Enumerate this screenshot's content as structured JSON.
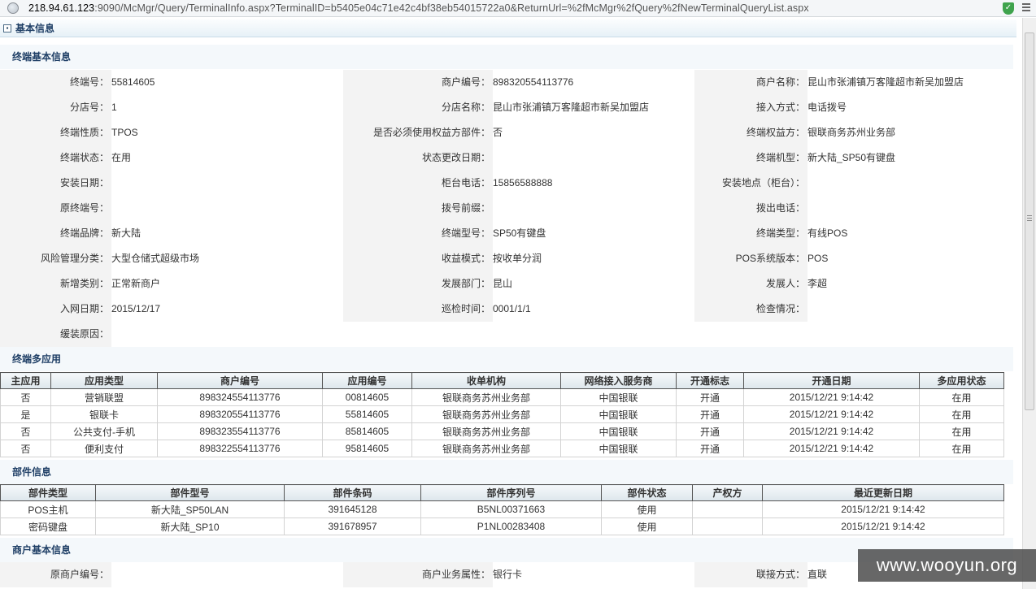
{
  "browser": {
    "url_host": "218.94.61.123",
    "url_rest": ":9090/McMgr/Query/TerminalInfo.aspx?TerminalID=b5405e04c71e42c4bf38eb54015722a0&ReturnUrl=%2fMcMgr%2fQuery%2fNewTerminalQueryList.aspx",
    "shield_glyph": "✓"
  },
  "panel": {
    "title": "基本信息",
    "collapse_glyph": "▪"
  },
  "terminal_basic": {
    "title": "终端基本信息",
    "rows": [
      [
        {
          "label": "终端号：",
          "value": "55814605"
        },
        {
          "label": "商户编号：",
          "value": "898320554113776"
        },
        {
          "label": "商户名称：",
          "value": "昆山市张浦镇万客隆超市新吴加盟店"
        }
      ],
      [
        {
          "label": "分店号：",
          "value": "1"
        },
        {
          "label": "分店名称：",
          "value": "昆山市张浦镇万客隆超市新吴加盟店"
        },
        {
          "label": "接入方式：",
          "value": "电话拨号"
        }
      ],
      [
        {
          "label": "终端性质：",
          "value": "TPOS"
        },
        {
          "label": "是否必须使用权益方部件：",
          "value": "否"
        },
        {
          "label": "终端权益方：",
          "value": "银联商务苏州业务部"
        }
      ],
      [
        {
          "label": "终端状态：",
          "value": "在用"
        },
        {
          "label": "状态更改日期：",
          "value": ""
        },
        {
          "label": "终端机型：",
          "value": "新大陆_SP50有键盘"
        }
      ],
      [
        {
          "label": "安装日期：",
          "value": ""
        },
        {
          "label": "柜台电话：",
          "value": "15856588888"
        },
        {
          "label": "安装地点（柜台）：",
          "value": ""
        }
      ],
      [
        {
          "label": "原终端号：",
          "value": ""
        },
        {
          "label": "拨号前缀：",
          "value": ""
        },
        {
          "label": "拨出电话：",
          "value": ""
        }
      ],
      [
        {
          "label": "终端品牌：",
          "value": "新大陆"
        },
        {
          "label": "终端型号：",
          "value": "SP50有键盘"
        },
        {
          "label": "终端类型：",
          "value": "有线POS"
        }
      ],
      [
        {
          "label": "风险管理分类：",
          "value": "大型仓储式超级市场"
        },
        {
          "label": "收益模式：",
          "value": "按收单分润"
        },
        {
          "label": "POS系统版本：",
          "value": "POS"
        }
      ],
      [
        {
          "label": "新增类别：",
          "value": "正常新商户"
        },
        {
          "label": "发展部门：",
          "value": "昆山"
        },
        {
          "label": "发展人：",
          "value": "李超"
        }
      ],
      [
        {
          "label": "入网日期：",
          "value": "2015/12/17"
        },
        {
          "label": "巡检时间：",
          "value": "0001/1/1"
        },
        {
          "label": "检查情况：",
          "value": ""
        }
      ]
    ],
    "last_row": {
      "label": "缓装原因：",
      "value": ""
    }
  },
  "multi_app": {
    "title": "终端多应用",
    "headers": [
      "主应用",
      "应用类型",
      "商户编号",
      "应用编号",
      "收单机构",
      "网络接入服务商",
      "开通标志",
      "开通日期",
      "多应用状态"
    ],
    "rows": [
      [
        "否",
        "营销联盟",
        "898324554113776",
        "00814605",
        "银联商务苏州业务部",
        "中国银联",
        "开通",
        "2015/12/21 9:14:42",
        "在用"
      ],
      [
        "是",
        "银联卡",
        "898320554113776",
        "55814605",
        "银联商务苏州业务部",
        "中国银联",
        "开通",
        "2015/12/21 9:14:42",
        "在用"
      ],
      [
        "否",
        "公共支付-手机",
        "898323554113776",
        "85814605",
        "银联商务苏州业务部",
        "中国银联",
        "开通",
        "2015/12/21 9:14:42",
        "在用"
      ],
      [
        "否",
        "便利支付",
        "898322554113776",
        "95814605",
        "银联商务苏州业务部",
        "中国银联",
        "开通",
        "2015/12/21 9:14:42",
        "在用"
      ]
    ]
  },
  "parts": {
    "title": "部件信息",
    "headers": [
      "部件类型",
      "部件型号",
      "部件条码",
      "部件序列号",
      "部件状态",
      "产权方",
      "最近更新日期"
    ],
    "rows": [
      [
        "POS主机",
        "新大陆_SP50LAN",
        "391645128",
        "B5NL00371663",
        "使用",
        "",
        "2015/12/21 9:14:42"
      ],
      [
        "密码键盘",
        "新大陆_SP10",
        "391678957",
        "P1NL00283408",
        "使用",
        "",
        "2015/12/21 9:14:42"
      ]
    ]
  },
  "merchant_basic": {
    "title": "商户基本信息",
    "rows": [
      [
        {
          "label": "原商户编号：",
          "value": ""
        },
        {
          "label": "商户业务属性：",
          "value": "银行卡"
        },
        {
          "label": "联接方式：",
          "value": "直联"
        }
      ]
    ]
  },
  "watermark": {
    "text": "www.wooyun.org"
  }
}
